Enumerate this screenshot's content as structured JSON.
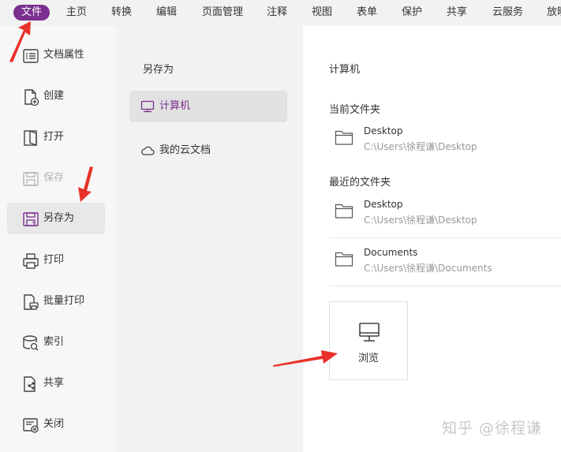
{
  "menubar": {
    "items": [
      "文件",
      "主页",
      "转换",
      "编辑",
      "页面管理",
      "注释",
      "视图",
      "表单",
      "保护",
      "共享",
      "云服务",
      "放映"
    ]
  },
  "sidebar": {
    "items": [
      {
        "label": "文档属性",
        "icon": "document-properties-icon"
      },
      {
        "label": "创建",
        "icon": "create-document-icon"
      },
      {
        "label": "打开",
        "icon": "open-document-icon"
      },
      {
        "label": "保存",
        "icon": "save-icon",
        "disabled": true
      },
      {
        "label": "另存为",
        "icon": "save-as-icon",
        "active": true
      },
      {
        "label": "打印",
        "icon": "printer-icon"
      },
      {
        "label": "批量打印",
        "icon": "batch-print-icon"
      },
      {
        "label": "索引",
        "icon": "index-icon"
      },
      {
        "label": "共享",
        "icon": "share-icon"
      },
      {
        "label": "关闭",
        "icon": "close-document-icon"
      }
    ]
  },
  "middle": {
    "title": "另存为",
    "items": [
      {
        "label": "计算机",
        "icon": "computer-icon",
        "active": true
      },
      {
        "label": "我的云文档",
        "icon": "cloud-icon"
      }
    ]
  },
  "right": {
    "title": "计算机",
    "current_folder_heading": "当前文件夹",
    "current_folders": [
      {
        "name": "Desktop",
        "path": "C:\\Users\\徐程谦\\Desktop"
      }
    ],
    "recent_folder_heading": "最近的文件夹",
    "recent_folders": [
      {
        "name": "Desktop",
        "path": "C:\\Users\\徐程谦\\Desktop"
      },
      {
        "name": "Documents",
        "path": "C:\\Users\\徐程谦\\Documents"
      }
    ],
    "browse_label": "浏览"
  },
  "watermark": "知乎 @徐程谦",
  "colors": {
    "accent": "#7b2f8e",
    "annotation_arrow": "#e8312a"
  }
}
